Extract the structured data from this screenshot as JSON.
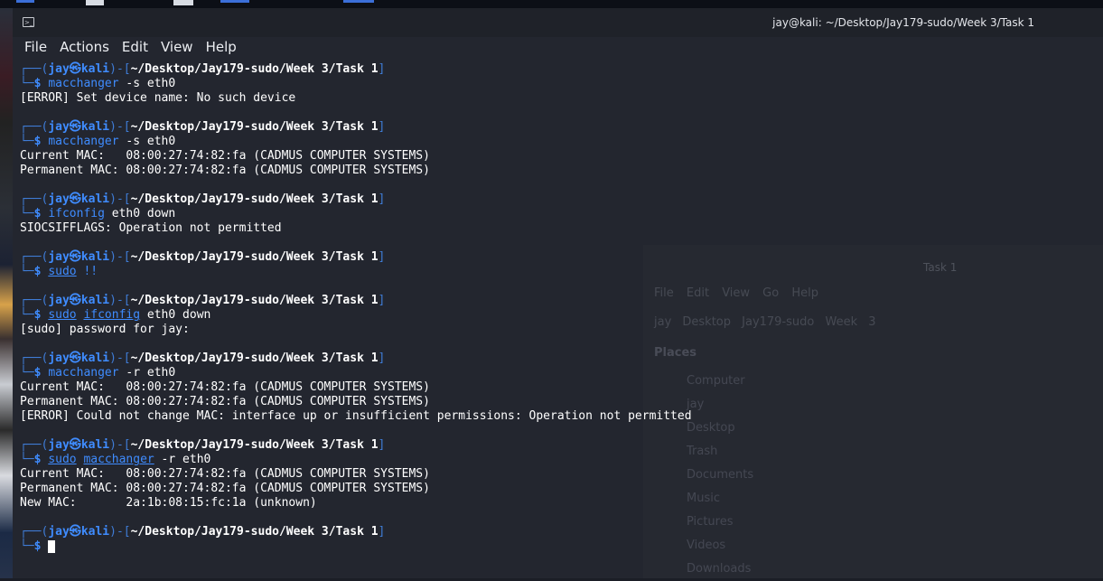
{
  "window": {
    "title": "jay@kali: ~/Desktop/Jay179-sudo/Week 3/Task 1",
    "menu": [
      "File",
      "Actions",
      "Edit",
      "View",
      "Help"
    ]
  },
  "background_window": {
    "title": "Task 1",
    "menu": "File Edit View Go Help",
    "path": "jay Desktop Jay179-sudo Week 3",
    "places_label": "Places",
    "places": [
      "Computer",
      "jay",
      "Desktop",
      "Trash",
      "Documents",
      "Music",
      "Pictures",
      "Videos",
      "Downloads"
    ]
  },
  "prompt": {
    "user": "jay",
    "at": "㉿",
    "host": "kali",
    "cwd": "~/Desktop/Jay179-sudo/Week 3/Task 1"
  },
  "blocks": [
    {
      "cmd": "macchanger",
      "args": " -s eth0",
      "sudo": false,
      "output": [
        "[ERROR] Set device name: No such device"
      ]
    },
    {
      "cmd": "macchanger",
      "args": " -s eth0",
      "sudo": false,
      "output": [
        "Current MAC:   08:00:27:74:82:fa (CADMUS COMPUTER SYSTEMS)",
        "Permanent MAC: 08:00:27:74:82:fa (CADMUS COMPUTER SYSTEMS)"
      ]
    },
    {
      "cmd": "ifconfig",
      "args": " eth0 down",
      "sudo": false,
      "output": [
        "SIOCSIFFLAGS: Operation not permitted"
      ]
    },
    {
      "cmd": "sudo",
      "args": " !!",
      "sudo": true,
      "inner": "",
      "output": []
    },
    {
      "cmd": "sudo",
      "args": " eth0 down",
      "sudo": true,
      "inner": "ifconfig",
      "output": [
        "[sudo] password for jay:"
      ]
    },
    {
      "cmd": "macchanger",
      "args": " -r eth0",
      "sudo": false,
      "output": [
        "Current MAC:   08:00:27:74:82:fa (CADMUS COMPUTER SYSTEMS)",
        "Permanent MAC: 08:00:27:74:82:fa (CADMUS COMPUTER SYSTEMS)",
        "[ERROR] Could not change MAC: interface up or insufficient permissions: Operation not permitted"
      ]
    },
    {
      "cmd": "sudo",
      "args": " -r eth0",
      "sudo": true,
      "inner": "macchanger",
      "output": [
        "Current MAC:   08:00:27:74:82:fa (CADMUS COMPUTER SYSTEMS)",
        "Permanent MAC: 08:00:27:74:82:fa (CADMUS COMPUTER SYSTEMS)",
        "New MAC:       2a:1b:08:15:fc:1a (unknown)"
      ]
    }
  ],
  "final_prompt": "$"
}
